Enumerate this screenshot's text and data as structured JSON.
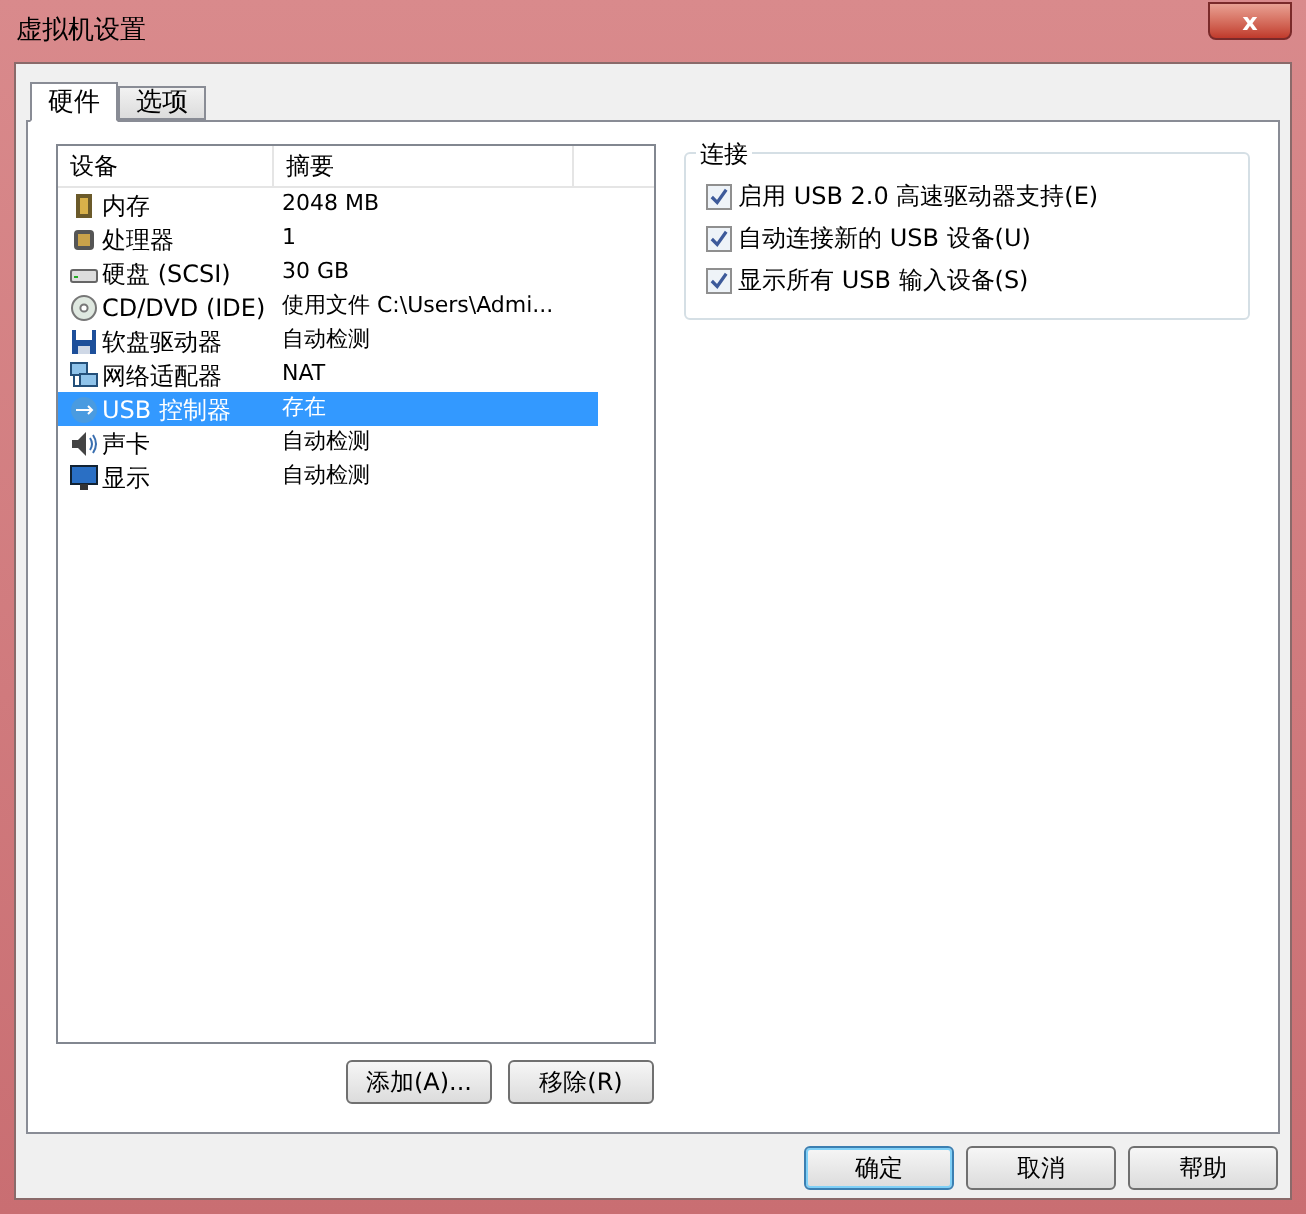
{
  "window": {
    "title": "虚拟机设置",
    "close": "x"
  },
  "tabs": [
    {
      "label": "硬件",
      "selected": true
    },
    {
      "label": "选项",
      "selected": false
    }
  ],
  "device_list": {
    "columns": [
      "设备",
      "摘要"
    ],
    "rows": [
      {
        "kind": "memory",
        "device": "内存",
        "summary": "2048 MB",
        "selected": false
      },
      {
        "kind": "cpu",
        "device": "处理器",
        "summary": "1",
        "selected": false
      },
      {
        "kind": "disk",
        "device": "硬盘 (SCSI)",
        "summary": "30 GB",
        "selected": false
      },
      {
        "kind": "cd",
        "device": "CD/DVD (IDE)",
        "summary": "使用文件 C:\\Users\\Admi...",
        "selected": false
      },
      {
        "kind": "floppy",
        "device": "软盘驱动器",
        "summary": "自动检测",
        "selected": false
      },
      {
        "kind": "network",
        "device": "网络适配器",
        "summary": "NAT",
        "selected": false
      },
      {
        "kind": "usb",
        "device": "USB 控制器",
        "summary": "存在",
        "selected": true
      },
      {
        "kind": "sound",
        "device": "声卡",
        "summary": "自动检测",
        "selected": false
      },
      {
        "kind": "display",
        "device": "显示",
        "summary": "自动检测",
        "selected": false
      }
    ]
  },
  "list_buttons": [
    "添加(A)...",
    "移除(R)"
  ],
  "connection": {
    "title": "连接",
    "options": [
      {
        "label": "启用 USB 2.0 高速驱动器支持(E)",
        "checked": true
      },
      {
        "label": "自动连接新的 USB 设备(U)",
        "checked": true
      },
      {
        "label": "显示所有 USB 输入设备(S)",
        "checked": true
      }
    ]
  },
  "dialog_buttons": [
    {
      "label": "确定",
      "default": true
    },
    {
      "label": "取消",
      "default": false
    },
    {
      "label": "帮助",
      "default": false
    }
  ]
}
